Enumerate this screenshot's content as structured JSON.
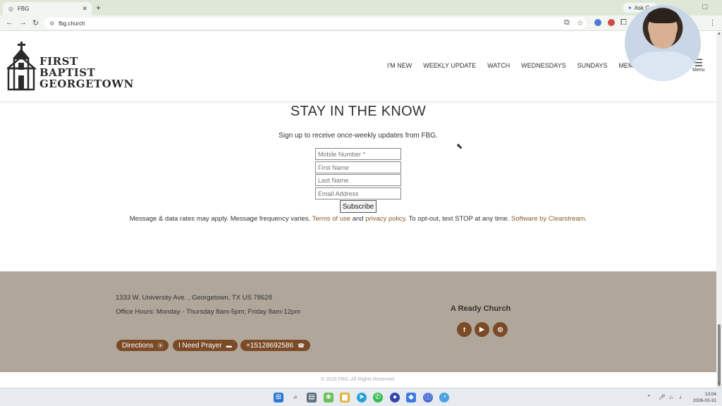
{
  "browser": {
    "tab_title": "FBG",
    "url": "fbg.church",
    "ask_tab": "Ask Ge"
  },
  "site": {
    "logo_lines": [
      "FIRST",
      "BAPTIST",
      "GEORGETOWN"
    ],
    "nav": [
      "I'M NEW",
      "WEEKLY UPDATE",
      "WATCH",
      "WEDNESDAYS",
      "SUNDAYS",
      "MEMBERS"
    ],
    "menu_label": "Menu"
  },
  "signup": {
    "heading": "STAY IN THE KNOW",
    "subheading": "Sign up to receive once-weekly updates from FBG.",
    "fields": [
      {
        "placeholder": "Mobile Number *"
      },
      {
        "placeholder": "First Name"
      },
      {
        "placeholder": "Last Name"
      },
      {
        "placeholder": "Email Address"
      }
    ],
    "subscribe_label": "Subscribe",
    "disclaimer_1": "Message & data rates may apply. Message frequency varies. ",
    "terms_link": "Terms of use",
    "and_text": " and ",
    "privacy_link": "privacy policy",
    "disclaimer_2": ". To opt-out, text STOP at any time. ",
    "software_link": "Software by Clearstream",
    "disclaimer_3": "."
  },
  "footer": {
    "address": "1333 W. University Ave. , Georgetown, TX US 78628",
    "hours": "Office Hours: Monday - Thursday 8am-5pm; Friday 8am-12pm",
    "buttons": [
      {
        "label": "Directions",
        "icon": "map-pin-icon"
      },
      {
        "label": "I Need Prayer",
        "icon": "chat-icon"
      },
      {
        "label": "+15128692586",
        "icon": "phone-icon"
      }
    ],
    "tagline": "A Ready Church",
    "social": [
      "facebook-icon",
      "youtube-icon",
      "instagram-icon"
    ],
    "copyright": "© 2026 FBG. All Rights Reserved."
  },
  "taskbar": {
    "time": "13:04",
    "date": "2026-03-31"
  },
  "colors": {
    "accent_brown": "#7b4a26",
    "footer_bg": "#b0a69a"
  }
}
